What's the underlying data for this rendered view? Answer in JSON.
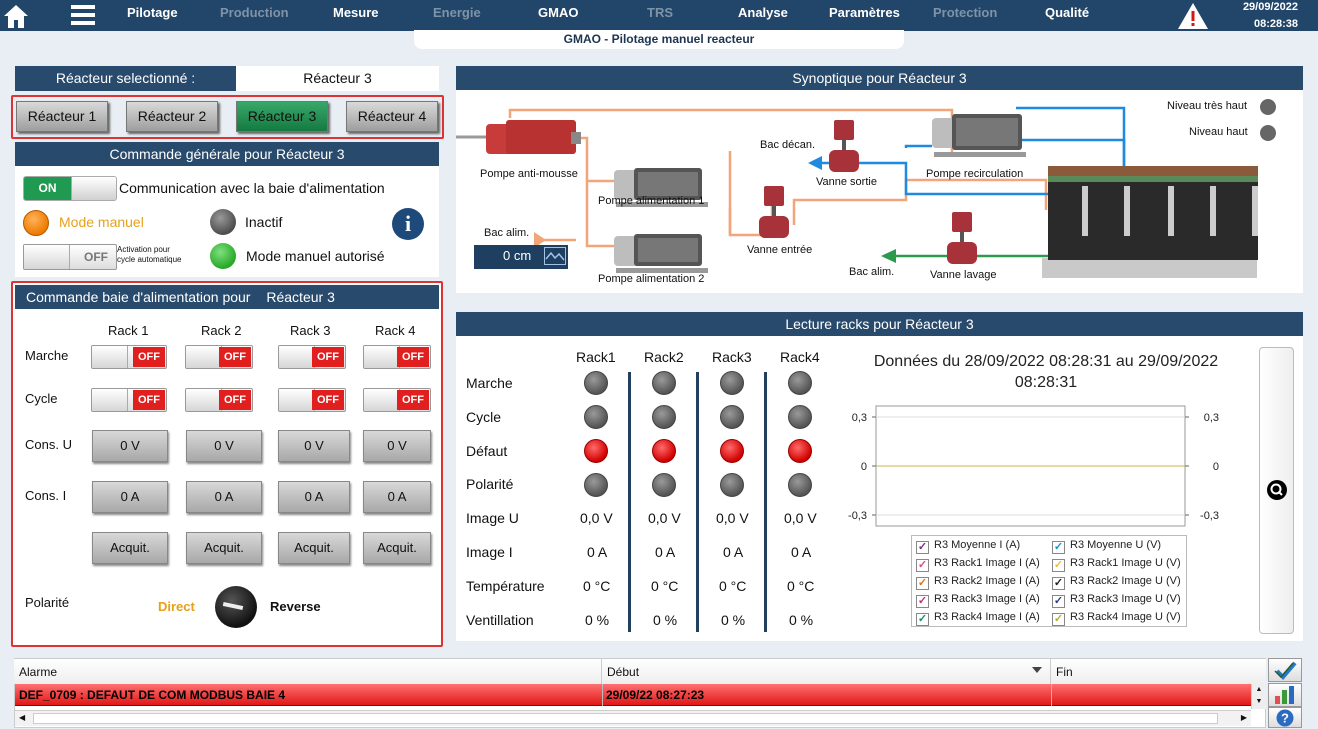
{
  "nav": {
    "items": [
      {
        "label": "Pilotage",
        "enabled": true
      },
      {
        "label": "Production",
        "enabled": false
      },
      {
        "label": "Mesure",
        "enabled": true
      },
      {
        "label": "Energie",
        "enabled": false
      },
      {
        "label": "GMAO",
        "enabled": true
      },
      {
        "label": "TRS",
        "enabled": false
      },
      {
        "label": "Analyse",
        "enabled": true
      },
      {
        "label": "Paramètres",
        "enabled": true
      },
      {
        "label": "Protection",
        "enabled": false
      },
      {
        "label": "Qualité",
        "enabled": true
      }
    ],
    "date": "29/09/2022",
    "time": "08:28:38",
    "subtitle": "GMAO - Pilotage manuel reacteur"
  },
  "selector": {
    "label": "Réacteur selectionné :",
    "value": "Réacteur 3",
    "buttons": [
      "Réacteur 1",
      "Réacteur 2",
      "Réacteur 3",
      "Réacteur 4"
    ],
    "selected_index": 2
  },
  "general": {
    "title": "Commande générale pour Réacteur 3",
    "comm_toggle": "ON",
    "comm_label": "Communication avec la baie d'alimentation",
    "mode_label": "Mode manuel",
    "inactive_label": "Inactif",
    "auto_toggle": "OFF",
    "auto_label_1": "Activation pour",
    "auto_label_2": "cycle automatique",
    "authorized_label": "Mode manuel autorisé"
  },
  "baie": {
    "title": "Commande baie d'alimentation pour",
    "title_reactor": "Réacteur 3",
    "racks": [
      "Rack 1",
      "Rack 2",
      "Rack 3",
      "Rack 4"
    ],
    "row_marche": "Marche",
    "row_cycle": "Cycle",
    "row_cons_u": "Cons. U",
    "row_cons_i": "Cons. I",
    "off_label": "OFF",
    "cons_u": [
      "0 V",
      "0 V",
      "0 V",
      "0 V"
    ],
    "cons_i": [
      "0 A",
      "0 A",
      "0 A",
      "0 A"
    ],
    "acquit": "Acquit.",
    "polarite": "Polarité",
    "direct": "Direct",
    "reverse": "Reverse"
  },
  "synoptic": {
    "title": "Synoptique pour Réacteur 3",
    "pompe_anti_mousse": "Pompe anti-mousse",
    "pompe_alim_1": "Pompe alimentation 1",
    "pompe_alim_2": "Pompe alimentation 2",
    "bac_decan": "Bac décan.",
    "vanne_sortie": "Vanne sortie",
    "pompe_recirc": "Pompe recirculation",
    "bac_alim_left": "Bac alim.",
    "level_value": "0 cm",
    "vanne_entree": "Vanne entrée",
    "bac_alim_right": "Bac alim.",
    "vanne_lavage": "Vanne lavage",
    "niveau_tres_haut": "Niveau très haut",
    "niveau_haut": "Niveau haut"
  },
  "racks_reading": {
    "title": "Lecture racks pour Réacteur 3",
    "headers": [
      "Rack1",
      "Rack2",
      "Rack3",
      "Rack4"
    ],
    "row_labels": [
      "Marche",
      "Cycle",
      "Défaut",
      "Polarité",
      "Image U",
      "Image I",
      "Température",
      "Ventillation"
    ],
    "image_u": [
      "0,0 V",
      "0,0 V",
      "0,0 V",
      "0,0 V"
    ],
    "image_i": [
      "0 A",
      "0 A",
      "0 A",
      "0 A"
    ],
    "temperature": [
      "0 °C",
      "0 °C",
      "0 °C",
      "0 °C"
    ],
    "ventilation": [
      "0 %",
      "0 %",
      "0 %",
      "0 %"
    ],
    "defaut_state": [
      "red",
      "red",
      "red",
      "red"
    ]
  },
  "chart_data": {
    "type": "line",
    "title": "Données du 28/09/2022 08:28:31 au 29/09/2022 08:28:31",
    "yticks_left": [
      "0,3",
      "0",
      "-0,3"
    ],
    "yticks_right": [
      "0,3",
      "0",
      "-0,3"
    ],
    "ylim": [
      -0.3,
      0.3
    ],
    "series": [
      {
        "name": "R3 Moyenne I (A)",
        "color": "#7b2d8e",
        "values": [
          0,
          0
        ]
      },
      {
        "name": "R3 Moyenne U (V)",
        "color": "#1f8fd0",
        "values": [
          0,
          0
        ]
      },
      {
        "name": "R3 Rack1 Image I (A)",
        "color": "#d94b8a",
        "values": [
          0,
          0
        ]
      },
      {
        "name": "R3 Rack1 Image U (V)",
        "color": "#e8c23a",
        "values": [
          0,
          0
        ]
      },
      {
        "name": "R3 Rack2 Image I (A)",
        "color": "#e0701c",
        "values": [
          0,
          0
        ]
      },
      {
        "name": "R3 Rack2 Image U (V)",
        "color": "#222222",
        "values": [
          0,
          0
        ]
      },
      {
        "name": "R3 Rack3 Image I (A)",
        "color": "#c0307a",
        "values": [
          0,
          0
        ]
      },
      {
        "name": "R3 Rack3 Image U (V)",
        "color": "#2a3f8a",
        "values": [
          0,
          0
        ]
      },
      {
        "name": "R3 Rack4 Image I (A)",
        "color": "#1f8a6a",
        "values": [
          0,
          0
        ]
      },
      {
        "name": "R3 Rack4 Image U (V)",
        "color": "#b0b030",
        "values": [
          0,
          0
        ]
      }
    ]
  },
  "alarms": {
    "col_alarme": "Alarme",
    "col_debut": "Début",
    "col_fin": "Fin",
    "rows": [
      {
        "alarme": "DEF_0709 : DEFAUT DE COM MODBUS BAIE 4",
        "debut": "29/09/22 08:27:23",
        "fin": ""
      }
    ]
  }
}
